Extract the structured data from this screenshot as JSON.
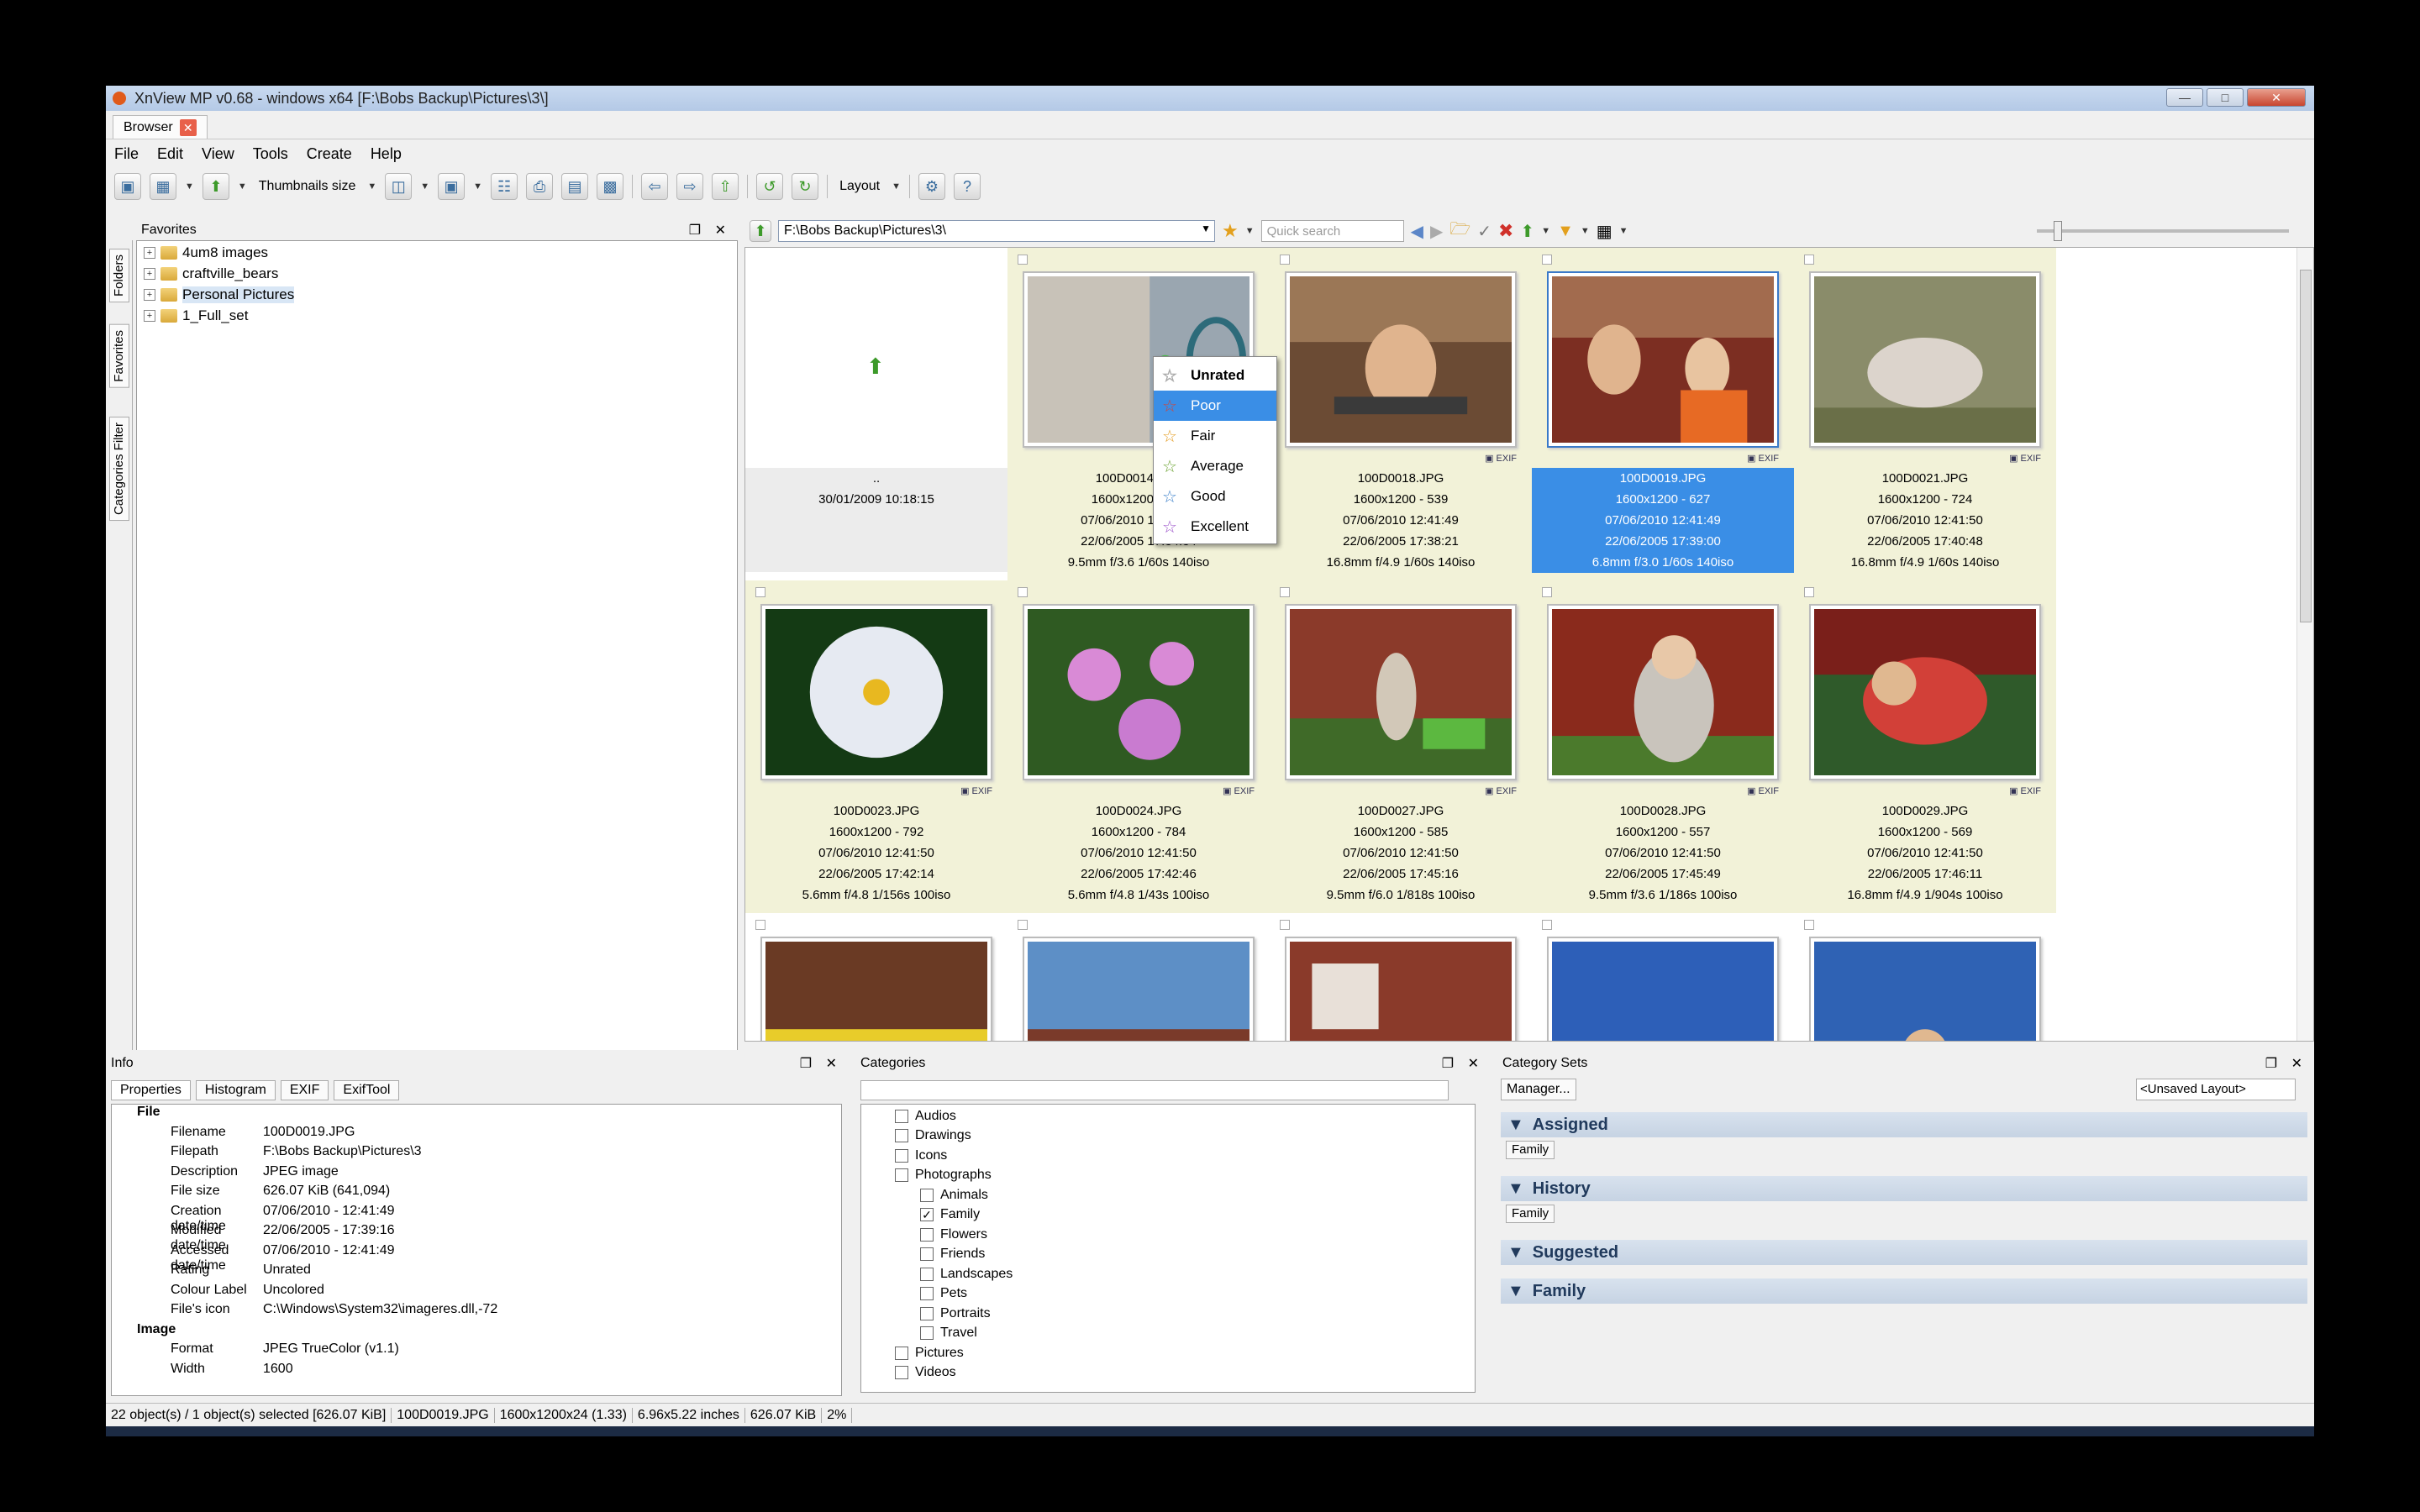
{
  "window": {
    "title": "XnView MP v0.68 - windows x64 [F:\\Bobs Backup\\Pictures\\3\\]"
  },
  "tab": {
    "label": "Browser"
  },
  "menu": [
    "File",
    "Edit",
    "View",
    "Tools",
    "Create",
    "Help"
  ],
  "toolbar": {
    "thumbnails_size": "Thumbnails size",
    "layout": "Layout"
  },
  "panels": {
    "favorites": "Favorites",
    "info": "Info",
    "categories": "Categories",
    "category_sets": "Category Sets"
  },
  "vertical_tabs": [
    "Folders",
    "Favorites",
    "Categories Filter"
  ],
  "favorites_tree": [
    "4um8 images",
    "craftville_bears",
    "Personal Pictures",
    "1_Full_set"
  ],
  "address": {
    "path": "F:\\Bobs Backup\\Pictures\\3\\",
    "quick_search_placeholder": "Quick search"
  },
  "updir": {
    "name": "..",
    "date": "30/01/2009 10:18:15"
  },
  "thumbnails": [
    {
      "name": "100D0014.JPG",
      "dims": "1600x1200 - 601",
      "created": "07/06/2010 12:41:49",
      "taken": "22/06/2005 17:34:34",
      "exif": "9.5mm f/3.6 1/60s 140iso",
      "selected": false
    },
    {
      "name": "100D0018.JPG",
      "dims": "1600x1200 - 539",
      "created": "07/06/2010 12:41:49",
      "taken": "22/06/2005 17:38:21",
      "exif": "16.8mm f/4.9 1/60s 140iso",
      "selected": false
    },
    {
      "name": "100D0019.JPG",
      "dims": "1600x1200 - 627",
      "created": "07/06/2010 12:41:49",
      "taken": "22/06/2005 17:39:00",
      "exif": "6.8mm f/3.0 1/60s 140iso",
      "selected": true
    },
    {
      "name": "100D0021.JPG",
      "dims": "1600x1200 - 724",
      "created": "07/06/2010 12:41:50",
      "taken": "22/06/2005 17:40:48",
      "exif": "16.8mm f/4.9 1/60s 140iso",
      "selected": false
    },
    {
      "name": "100D0023.JPG",
      "dims": "1600x1200 - 792",
      "created": "07/06/2010 12:41:50",
      "taken": "22/06/2005 17:42:14",
      "exif": "5.6mm f/4.8 1/156s 100iso",
      "selected": false
    },
    {
      "name": "100D0024.JPG",
      "dims": "1600x1200 - 784",
      "created": "07/06/2010 12:41:50",
      "taken": "22/06/2005 17:42:46",
      "exif": "5.6mm f/4.8 1/43s 100iso",
      "selected": false
    },
    {
      "name": "100D0027.JPG",
      "dims": "1600x1200 - 585",
      "created": "07/06/2010 12:41:50",
      "taken": "22/06/2005 17:45:16",
      "exif": "9.5mm f/6.0 1/818s 100iso",
      "selected": false
    },
    {
      "name": "100D0028.JPG",
      "dims": "1600x1200 - 557",
      "created": "07/06/2010 12:41:50",
      "taken": "22/06/2005 17:45:49",
      "exif": "9.5mm f/3.6 1/186s 100iso",
      "selected": false
    },
    {
      "name": "100D0029.JPG",
      "dims": "1600x1200 - 569",
      "created": "07/06/2010 12:41:50",
      "taken": "22/06/2005 17:46:11",
      "exif": "16.8mm f/4.9 1/904s 100iso",
      "selected": false
    }
  ],
  "rating_menu": [
    "Unrated",
    "Poor",
    "Fair",
    "Average",
    "Good",
    "Excellent"
  ],
  "rating_colors": [
    "#aaaaaa",
    "#d0453b",
    "#e39a1d",
    "#6aa12f",
    "#3a7fc9",
    "#9a4fc9"
  ],
  "info_tabs": [
    "Properties",
    "Histogram",
    "EXIF",
    "ExifTool"
  ],
  "properties": {
    "section_file": "File",
    "rows": [
      {
        "k": "Filename",
        "v": "100D0019.JPG"
      },
      {
        "k": "Filepath",
        "v": "F:\\Bobs Backup\\Pictures\\3"
      },
      {
        "k": "Description",
        "v": "JPEG image"
      },
      {
        "k": "File size",
        "v": "626.07 KiB (641,094)"
      },
      {
        "k": "Creation date/time",
        "v": "07/06/2010 - 12:41:49"
      },
      {
        "k": "Modified date/time",
        "v": "22/06/2005 - 17:39:16"
      },
      {
        "k": "Accessed date/time",
        "v": "07/06/2010 - 12:41:49"
      },
      {
        "k": "Rating",
        "v": "Unrated"
      },
      {
        "k": "Colour Label",
        "v": "Uncolored"
      },
      {
        "k": "File's icon",
        "v": "C:\\Windows\\System32\\imageres.dll,-72"
      }
    ],
    "section_image": "Image",
    "image_rows": [
      {
        "k": "Format",
        "v": "JPEG TrueColor (v1.1)"
      },
      {
        "k": "Width",
        "v": "1600"
      }
    ]
  },
  "categories": [
    {
      "label": "Audios",
      "level": 0,
      "checked": false
    },
    {
      "label": "Drawings",
      "level": 0,
      "checked": false
    },
    {
      "label": "Icons",
      "level": 0,
      "checked": false
    },
    {
      "label": "Photographs",
      "level": 0,
      "checked": false
    },
    {
      "label": "Animals",
      "level": 1,
      "checked": false
    },
    {
      "label": "Family",
      "level": 1,
      "checked": true
    },
    {
      "label": "Flowers",
      "level": 1,
      "checked": false
    },
    {
      "label": "Friends",
      "level": 1,
      "checked": false
    },
    {
      "label": "Landscapes",
      "level": 1,
      "checked": false
    },
    {
      "label": "Pets",
      "level": 1,
      "checked": false
    },
    {
      "label": "Portraits",
      "level": 1,
      "checked": false
    },
    {
      "label": "Travel",
      "level": 1,
      "checked": false
    },
    {
      "label": "Pictures",
      "level": 0,
      "checked": false
    },
    {
      "label": "Videos",
      "level": 0,
      "checked": false
    }
  ],
  "category_sets": {
    "manager": "Manager...",
    "layout": "<Unsaved Layout>",
    "sections": [
      {
        "title": "Assigned",
        "chip": "Family"
      },
      {
        "title": "History",
        "chip": "Family"
      },
      {
        "title": "Suggested",
        "chip": ""
      },
      {
        "title": "Family",
        "chip": ""
      }
    ]
  },
  "status": [
    "22 object(s) / 1 object(s) selected [626.07 KiB]",
    "100D0019.JPG",
    "1600x1200x24 (1.33)",
    "6.96x5.22 inches",
    "626.07 KiB",
    "2%"
  ]
}
